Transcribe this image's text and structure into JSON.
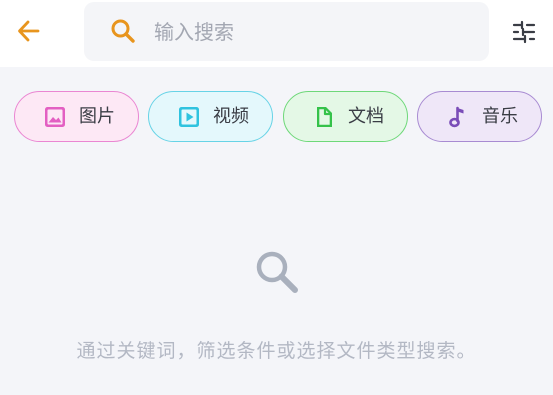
{
  "header": {
    "back_icon": "arrow-left-icon",
    "search": {
      "placeholder": "输入搜索",
      "value": "",
      "icon": "search-icon"
    },
    "filter_icon": "sliders-icon"
  },
  "filters": [
    {
      "label": "图片",
      "icon": "image-icon",
      "color": "#e35fc2"
    },
    {
      "label": "视频",
      "icon": "play-video-icon",
      "color": "#2fc3df"
    },
    {
      "label": "文档",
      "icon": "document-icon",
      "color": "#35c24a"
    },
    {
      "label": "音乐",
      "icon": "music-note-icon",
      "color": "#7a4db8"
    }
  ],
  "empty_state": {
    "icon": "search-icon",
    "message": "通过关键词，筛选条件或选择文件类型搜索。"
  },
  "colors": {
    "accent": "#e8951e",
    "background": "#f4f5f9",
    "muted_text": "#b3b8c4"
  }
}
